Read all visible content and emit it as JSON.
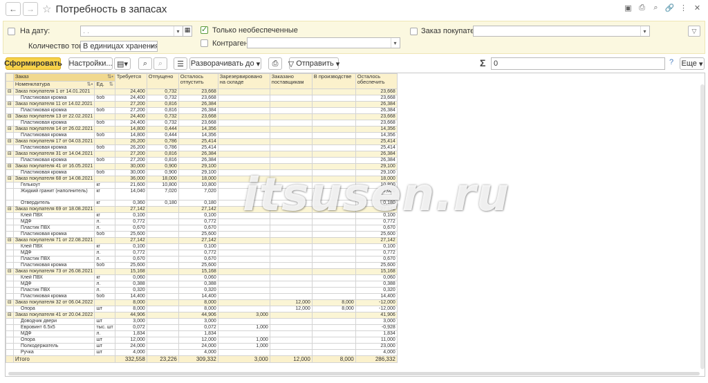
{
  "window": {
    "title": "Потребность в запасах"
  },
  "filters": {
    "date_label": "На дату:",
    "date_value": ". .",
    "qty_label": "Количество товаров:",
    "qty_value": "В единицах хранения",
    "only_unsecured_label": "Только необеспеченные",
    "only_unsecured_checked": true,
    "counterparty_label": "Контрагент:",
    "counterparty_value": "",
    "customer_order_label": "Заказ покупателя:",
    "customer_order_value": ""
  },
  "toolbar": {
    "generate": "Сформировать",
    "settings": "Настройки...",
    "expand": "Разворачивать до",
    "send": "Отправить",
    "sum_value": "0",
    "more": "Еще",
    "help": "?"
  },
  "icons": [
    "back-icon",
    "forward-icon",
    "star-icon",
    "save-icon",
    "print-icon",
    "search-icon",
    "link-icon",
    "more-vert-icon",
    "close-icon",
    "calendar-icon",
    "filter-icon",
    "variants-icon",
    "find-icon",
    "cancel-search-icon",
    "sort-icon",
    "printer-icon",
    "send-icon",
    "sigma-icon"
  ],
  "table": {
    "headers": {
      "order": "Заказ",
      "nomenclature": "Номенклатура",
      "unit": "Ед.",
      "required": "Требуется",
      "released": "Отпущено",
      "remain_release": "Осталось отпустить",
      "reserved": "Зарезервировано на складе",
      "ordered_suppliers": "Заказано поставщикам",
      "in_production": "В производстве",
      "remain_secure": "Осталось обеспечить"
    },
    "rows": [
      {
        "type": "grp",
        "name": "Заказ покупателя 1 от 14.01.2021",
        "unit": "",
        "req": "24,400",
        "rel": "0,732",
        "rem": "23,668",
        "res": "",
        "ord": "",
        "prod": "",
        "sec": "23,668"
      },
      {
        "type": "item",
        "name": "Пластиковая кромка",
        "unit": "боб",
        "req": "24,400",
        "rel": "0,732",
        "rem": "23,668",
        "res": "",
        "ord": "",
        "prod": "",
        "sec": "23,668"
      },
      {
        "type": "grp",
        "name": "Заказ покупателя 11 от 14.02.2021",
        "unit": "",
        "req": "27,200",
        "rel": "0,816",
        "rem": "26,384",
        "res": "",
        "ord": "",
        "prod": "",
        "sec": "26,384"
      },
      {
        "type": "item",
        "name": "Пластиковая кромка",
        "unit": "боб",
        "req": "27,200",
        "rel": "0,816",
        "rem": "26,384",
        "res": "",
        "ord": "",
        "prod": "",
        "sec": "26,384"
      },
      {
        "type": "grp",
        "name": "Заказ покупателя 13 от 22.02.2021",
        "unit": "",
        "req": "24,400",
        "rel": "0,732",
        "rem": "23,668",
        "res": "",
        "ord": "",
        "prod": "",
        "sec": "23,668"
      },
      {
        "type": "item",
        "name": "Пластиковая кромка",
        "unit": "боб",
        "req": "24,400",
        "rel": "0,732",
        "rem": "23,668",
        "res": "",
        "ord": "",
        "prod": "",
        "sec": "23,668"
      },
      {
        "type": "grp",
        "name": "Заказ покупателя 14 от 26.02.2021",
        "unit": "",
        "req": "14,800",
        "rel": "0,444",
        "rem": "14,356",
        "res": "",
        "ord": "",
        "prod": "",
        "sec": "14,356"
      },
      {
        "type": "item",
        "name": "Пластиковая кромка",
        "unit": "боб",
        "req": "14,800",
        "rel": "0,444",
        "rem": "14,356",
        "res": "",
        "ord": "",
        "prod": "",
        "sec": "14,356"
      },
      {
        "type": "grp",
        "name": "Заказ покупателя 17 от 04.03.2021",
        "unit": "",
        "req": "26,200",
        "rel": "0,786",
        "rem": "25,414",
        "res": "",
        "ord": "",
        "prod": "",
        "sec": "25,414"
      },
      {
        "type": "item",
        "name": "Пластиковая кромка",
        "unit": "боб",
        "req": "26,200",
        "rel": "0,786",
        "rem": "25,414",
        "res": "",
        "ord": "",
        "prod": "",
        "sec": "25,414"
      },
      {
        "type": "grp",
        "name": "Заказ покупателя 31 от 14.04.2021",
        "unit": "",
        "req": "27,200",
        "rel": "0,816",
        "rem": "26,384",
        "res": "",
        "ord": "",
        "prod": "",
        "sec": "26,384"
      },
      {
        "type": "item",
        "name": "Пластиковая кромка",
        "unit": "боб",
        "req": "27,200",
        "rel": "0,816",
        "rem": "26,384",
        "res": "",
        "ord": "",
        "prod": "",
        "sec": "26,384"
      },
      {
        "type": "grp",
        "name": "Заказ покупателя 41 от 16.05.2021",
        "unit": "",
        "req": "30,000",
        "rel": "0,900",
        "rem": "29,100",
        "res": "",
        "ord": "",
        "prod": "",
        "sec": "29,100"
      },
      {
        "type": "item",
        "name": "Пластиковая кромка",
        "unit": "боб",
        "req": "30,000",
        "rel": "0,900",
        "rem": "29,100",
        "res": "",
        "ord": "",
        "prod": "",
        "sec": "29,100"
      },
      {
        "type": "grp",
        "name": "Заказ покупателя 68 от 14.08.2021",
        "unit": "",
        "req": "36,000",
        "rel": "18,000",
        "rem": "18,000",
        "res": "",
        "ord": "",
        "prod": "",
        "sec": "18,000"
      },
      {
        "type": "item",
        "name": "Гелькоут",
        "unit": "кг",
        "req": "21,600",
        "rel": "10,800",
        "rem": "10,800",
        "res": "",
        "ord": "",
        "prod": "",
        "sec": "10,800"
      },
      {
        "type": "item",
        "tall": true,
        "name": "Жидкий гранит (наполнитель)",
        "unit": "кг",
        "req": "14,040",
        "rel": "7,020",
        "rem": "7,020",
        "res": "",
        "ord": "",
        "prod": "",
        "sec": "7,020"
      },
      {
        "type": "item",
        "name": "Отвердитель",
        "unit": "кг",
        "req": "0,360",
        "rel": "0,180",
        "rem": "0,180",
        "res": "",
        "ord": "",
        "prod": "",
        "sec": "0,180"
      },
      {
        "type": "grp",
        "name": "Заказ покупателя 69 от 18.08.2021",
        "unit": "",
        "req": "27,142",
        "rel": "",
        "rem": "27,142",
        "res": "",
        "ord": "",
        "prod": "",
        "sec": "27,142"
      },
      {
        "type": "item",
        "name": "Клей ПВХ",
        "unit": "кг",
        "req": "0,100",
        "rel": "",
        "rem": "0,100",
        "res": "",
        "ord": "",
        "prod": "",
        "sec": "0,100"
      },
      {
        "type": "item",
        "name": "МДФ",
        "unit": "л.",
        "req": "0,772",
        "rel": "",
        "rem": "0,772",
        "res": "",
        "ord": "",
        "prod": "",
        "sec": "0,772"
      },
      {
        "type": "item",
        "name": "Пластик ПВХ",
        "unit": "л.",
        "req": "0,670",
        "rel": "",
        "rem": "0,670",
        "res": "",
        "ord": "",
        "prod": "",
        "sec": "0,670"
      },
      {
        "type": "item",
        "name": "Пластиковая кромка",
        "unit": "боб",
        "req": "25,600",
        "rel": "",
        "rem": "25,600",
        "res": "",
        "ord": "",
        "prod": "",
        "sec": "25,600"
      },
      {
        "type": "grp",
        "name": "Заказ покупателя 71 от 22.08.2021",
        "unit": "",
        "req": "27,142",
        "rel": "",
        "rem": "27,142",
        "res": "",
        "ord": "",
        "prod": "",
        "sec": "27,142"
      },
      {
        "type": "item",
        "name": "Клей ПВХ",
        "unit": "кг",
        "req": "0,100",
        "rel": "",
        "rem": "0,100",
        "res": "",
        "ord": "",
        "prod": "",
        "sec": "0,100"
      },
      {
        "type": "item",
        "name": "МДФ",
        "unit": "л.",
        "req": "0,772",
        "rel": "",
        "rem": "0,772",
        "res": "",
        "ord": "",
        "prod": "",
        "sec": "0,772"
      },
      {
        "type": "item",
        "name": "Пластик ПВХ",
        "unit": "л.",
        "req": "0,670",
        "rel": "",
        "rem": "0,670",
        "res": "",
        "ord": "",
        "prod": "",
        "sec": "0,670"
      },
      {
        "type": "item",
        "name": "Пластиковая кромка",
        "unit": "боб",
        "req": "25,600",
        "rel": "",
        "rem": "25,600",
        "res": "",
        "ord": "",
        "prod": "",
        "sec": "25,600"
      },
      {
        "type": "grp",
        "name": "Заказ покупателя 73 от 26.08.2021",
        "unit": "",
        "req": "15,168",
        "rel": "",
        "rem": "15,168",
        "res": "",
        "ord": "",
        "prod": "",
        "sec": "15,168"
      },
      {
        "type": "item",
        "name": "Клей ПВХ",
        "unit": "кг",
        "req": "0,060",
        "rel": "",
        "rem": "0,060",
        "res": "",
        "ord": "",
        "prod": "",
        "sec": "0,060"
      },
      {
        "type": "item",
        "name": "МДФ",
        "unit": "л.",
        "req": "0,388",
        "rel": "",
        "rem": "0,388",
        "res": "",
        "ord": "",
        "prod": "",
        "sec": "0,388"
      },
      {
        "type": "item",
        "name": "Пластик ПВХ",
        "unit": "л.",
        "req": "0,320",
        "rel": "",
        "rem": "0,320",
        "res": "",
        "ord": "",
        "prod": "",
        "sec": "0,320"
      },
      {
        "type": "item",
        "name": "Пластиковая кромка",
        "unit": "боб",
        "req": "14,400",
        "rel": "",
        "rem": "14,400",
        "res": "",
        "ord": "",
        "prod": "",
        "sec": "14,400"
      },
      {
        "type": "grp",
        "name": "Заказ покупателя 32 от 06.04.2022",
        "unit": "",
        "req": "8,000",
        "rel": "",
        "rem": "8,000",
        "res": "",
        "ord": "12,000",
        "prod": "8,000",
        "sec": "-12,000"
      },
      {
        "type": "item",
        "name": "Опора",
        "unit": "шт",
        "req": "8,000",
        "rel": "",
        "rem": "8,000",
        "res": "",
        "ord": "12,000",
        "prod": "8,000",
        "sec": "-12,000"
      },
      {
        "type": "grp",
        "name": "Заказ покупателя 41 от 20.04.2022",
        "unit": "",
        "req": "44,906",
        "rel": "",
        "rem": "44,906",
        "res": "3,000",
        "ord": "",
        "prod": "",
        "sec": "41,906"
      },
      {
        "type": "item",
        "name": "Доводчик двери",
        "unit": "шт",
        "req": "3,000",
        "rel": "",
        "rem": "3,000",
        "res": "",
        "ord": "",
        "prod": "",
        "sec": "3,000"
      },
      {
        "type": "item",
        "name": "Евровинт 6.5х5",
        "unit": "тыс. шт",
        "req": "0,072",
        "rel": "",
        "rem": "0,072",
        "res": "1,000",
        "ord": "",
        "prod": "",
        "sec": "-0,928"
      },
      {
        "type": "item",
        "name": "МДФ",
        "unit": "л.",
        "req": "1,834",
        "rel": "",
        "rem": "1,834",
        "res": "",
        "ord": "",
        "prod": "",
        "sec": "1,834"
      },
      {
        "type": "item",
        "name": "Опора",
        "unit": "шт",
        "req": "12,000",
        "rel": "",
        "rem": "12,000",
        "res": "1,000",
        "ord": "",
        "prod": "",
        "sec": "11,000"
      },
      {
        "type": "item",
        "name": "Полкодержатель",
        "unit": "шт",
        "req": "24,000",
        "rel": "",
        "rem": "24,000",
        "res": "1,000",
        "ord": "",
        "prod": "",
        "sec": "23,000"
      },
      {
        "type": "item",
        "name": "Ручка",
        "unit": "шт",
        "req": "4,000",
        "rel": "",
        "rem": "4,000",
        "res": "",
        "ord": "",
        "prod": "",
        "sec": "4,000"
      }
    ],
    "total": {
      "name": "Итого",
      "req": "332,558",
      "rel": "23,226",
      "rem": "309,332",
      "res": "3,000",
      "ord": "12,000",
      "prod": "8,000",
      "sec": "286,332"
    }
  },
  "watermark": "itsusen.ru"
}
